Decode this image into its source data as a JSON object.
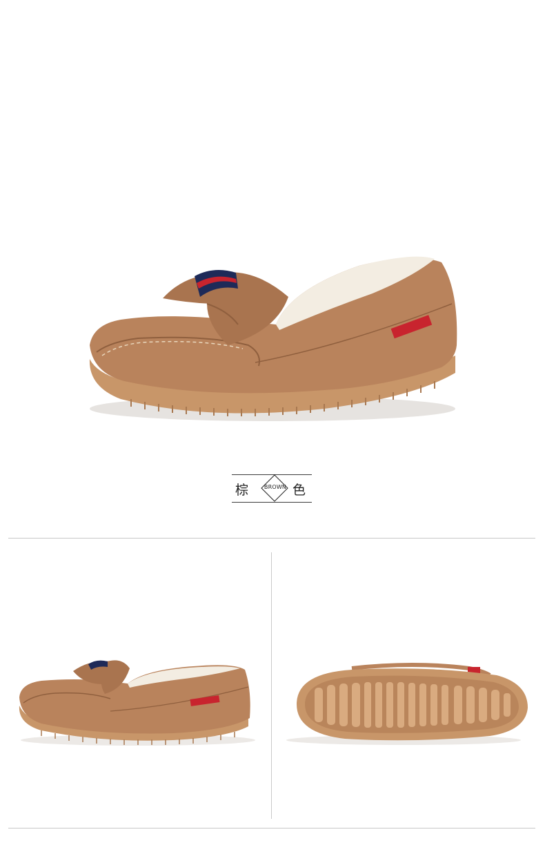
{
  "caption": {
    "left_char": "棕",
    "right_char": "色",
    "badge": "BROWN"
  },
  "product": {
    "color_name": "BROWN",
    "colors": {
      "suede": "#b9835c",
      "suede_dark": "#8f5f3e",
      "fur": "#f3ede2",
      "sole": "#c89669",
      "label_red": "#c8242e",
      "stripe_navy": "#1e2a58"
    }
  },
  "views": {
    "hero": "hero-side-view",
    "left": "side-view",
    "right": "sole-view"
  }
}
